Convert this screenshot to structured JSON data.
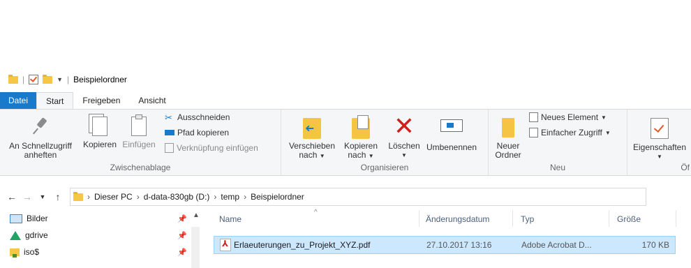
{
  "window": {
    "title": "Beispielordner"
  },
  "tabs": [
    {
      "label": "Datei"
    },
    {
      "label": "Start"
    },
    {
      "label": "Freigeben"
    },
    {
      "label": "Ansicht"
    }
  ],
  "ribbon": {
    "clipboard": {
      "pin_label_line1": "An Schnellzugriff",
      "pin_label_line2": "anheften",
      "copy_label": "Kopieren",
      "paste_label": "Einfügen",
      "cut_label": "Ausschneiden",
      "copy_path_label": "Pfad kopieren",
      "paste_shortcut_label": "Verknüpfung einfügen",
      "group_label": "Zwischenablage"
    },
    "organize": {
      "move_label_line1": "Verschieben",
      "move_label_line2": "nach",
      "copyto_label_line1": "Kopieren",
      "copyto_label_line2": "nach",
      "delete_label": "Löschen",
      "rename_label": "Umbenennen",
      "group_label": "Organisieren"
    },
    "new": {
      "new_folder_line1": "Neuer",
      "new_folder_line2": "Ordner",
      "new_item_label": "Neues Element",
      "easy_access_label": "Einfacher Zugriff",
      "group_label": "Neu"
    },
    "open": {
      "properties_label": "Eigenschaften",
      "group_label_partial": "Öf"
    }
  },
  "address": {
    "crumbs": [
      "Dieser PC",
      "d-data-830gb (D:)",
      "temp",
      "Beispielordner"
    ]
  },
  "navpane": {
    "items": [
      {
        "label": "Bilder",
        "icon": "pictures-icon"
      },
      {
        "label": "gdrive",
        "icon": "google-drive-icon"
      },
      {
        "label": "iso$",
        "icon": "shared-folder-icon"
      }
    ]
  },
  "filelist": {
    "columns": {
      "name": "Name",
      "date": "Änderungsdatum",
      "type": "Typ",
      "size": "Größe"
    },
    "rows": [
      {
        "name": "Erlaeuterungen_zu_Projekt_XYZ.pdf",
        "date": "27.10.2017 13:16",
        "type": "Adobe Acrobat D...",
        "size": "170 KB",
        "icon": "pdf-icon"
      }
    ]
  },
  "colors": {
    "file_tab": "#1979ca",
    "selection": "#cce8ff",
    "delete_red": "#d0201c"
  }
}
